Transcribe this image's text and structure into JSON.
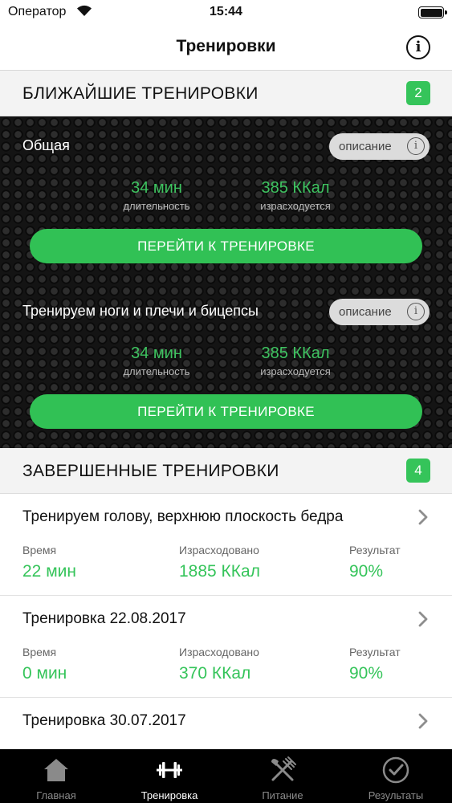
{
  "status": {
    "carrier": "Оператор",
    "time": "15:44"
  },
  "nav": {
    "title": "Тренировки",
    "info_icon": "info-icon"
  },
  "upcoming": {
    "title": "БЛИЖАЙШИЕ ТРЕНИРОВКИ",
    "count": "2",
    "items": [
      {
        "name": "Общая",
        "desc_label": "описание",
        "duration": "34 мин",
        "duration_label": "длительность",
        "calories": "385 ККал",
        "calories_label": "израсходуется",
        "button": "ПЕРЕЙТИ К ТРЕНИРОВКЕ"
      },
      {
        "name": "Тренируем ноги и плечи и бицепсы",
        "desc_label": "описание",
        "duration": "34 мин",
        "duration_label": "длительность",
        "calories": "385 ККал",
        "calories_label": "израсходуется",
        "button": "ПЕРЕЙТИ К ТРЕНИРОВКЕ"
      }
    ]
  },
  "completed": {
    "title": "ЗАВЕРШЕННЫЕ ТРЕНИРОВКИ",
    "count": "4",
    "items": [
      {
        "name": "Тренируем голову, верхнюю плоскость бедра",
        "time_label": "Время",
        "time": "22 мин",
        "spent_label": "Израсходовано",
        "spent": "1885 ККал",
        "result_label": "Результат",
        "result": "90%"
      },
      {
        "name": "Тренировка 22.08.2017",
        "time_label": "Время",
        "time": "0 мин",
        "spent_label": "Израсходовано",
        "spent": "370 ККал",
        "result_label": "Результат",
        "result": "90%"
      },
      {
        "name": "Тренировка 30.07.2017"
      }
    ]
  },
  "tabs": [
    {
      "label": "Главная",
      "icon": "home-icon",
      "active": false
    },
    {
      "label": "Тренировка",
      "icon": "dumbbell-icon",
      "active": true
    },
    {
      "label": "Питание",
      "icon": "fork-knife-icon",
      "active": false
    },
    {
      "label": "Результаты",
      "icon": "checkmark-circle-icon",
      "active": false
    }
  ],
  "colors": {
    "accent": "#35c45a",
    "dark_panel": "#141414",
    "tab_bar": "#000000",
    "tab_inactive": "#8a8a8a"
  }
}
